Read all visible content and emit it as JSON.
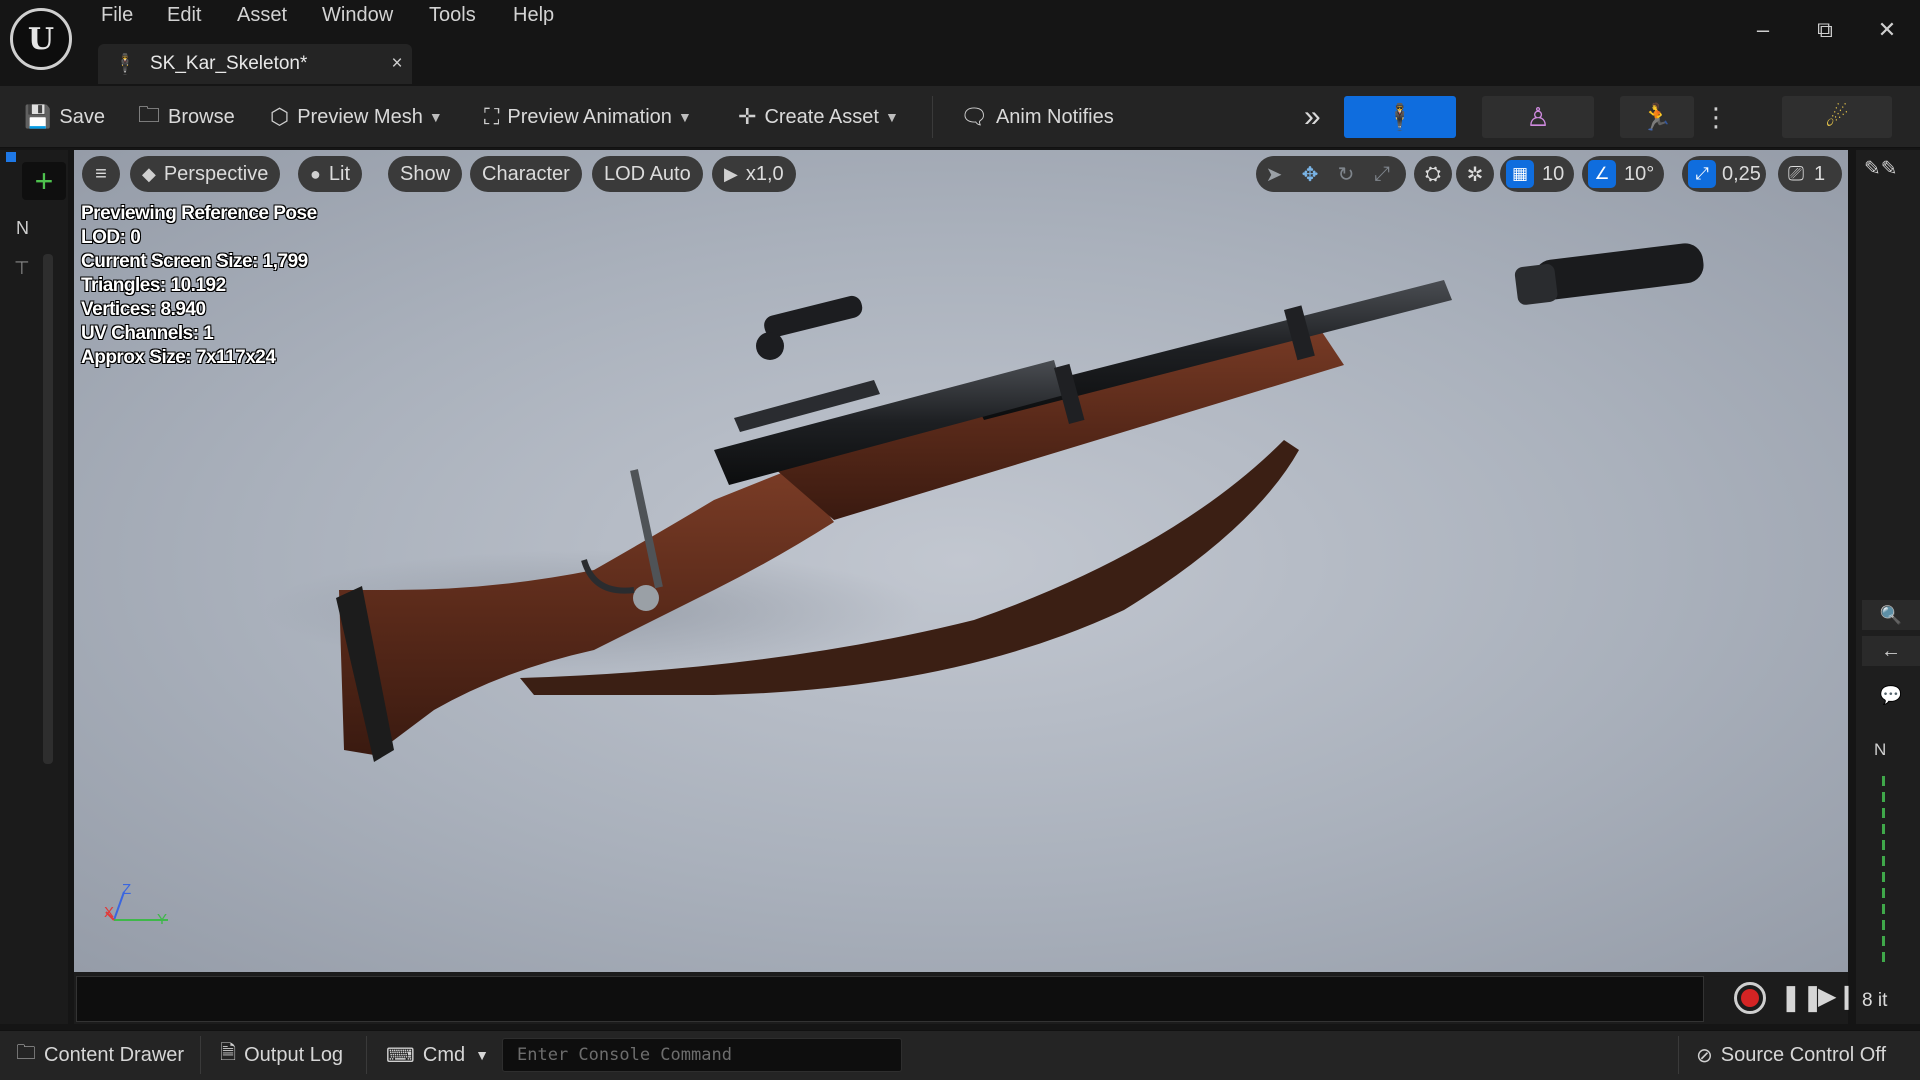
{
  "menu": [
    "File",
    "Edit",
    "Asset",
    "Window",
    "Tools",
    "Help"
  ],
  "tab": {
    "label": "SK_Kar_Skeleton*",
    "close": "×"
  },
  "window_controls": {
    "minimize": "–",
    "restore": "⧉",
    "close": "✕"
  },
  "toolbar": {
    "save": "Save",
    "browse": "Browse",
    "preview_mesh": "Preview Mesh",
    "preview_animation": "Preview Animation",
    "create_asset": "Create Asset",
    "anim_notifies": "Anim Notifies",
    "overflow": "»"
  },
  "viewport": {
    "menu_icon": "≡",
    "perspective": "Perspective",
    "lit": "Lit",
    "show": "Show",
    "character": "Character",
    "lod": "LOD Auto",
    "play_rate": "x1,0",
    "grid_snap": "10",
    "rotation_snap": "10°",
    "scale_snap": "0,25",
    "camera_speed": "1",
    "stats": [
      "Previewing Reference Pose",
      "LOD: 0",
      "Current Screen Size: 1,799",
      "Triangles: 10.192",
      "Vertices: 8.940",
      "UV Channels: 1",
      "Approx Size: 7x117x24"
    ],
    "axis_labels": {
      "z": "Z",
      "x": "X",
      "y": "Y"
    }
  },
  "left_panel": {
    "add": "+",
    "n_label": "N"
  },
  "right_panel": {
    "rate": "8 it",
    "n_label": "N"
  },
  "statusbar": {
    "content_drawer": "Content Drawer",
    "output_log": "Output Log",
    "cmd": "Cmd",
    "console_placeholder": "Enter Console Command",
    "source_control": "Source Control Off"
  },
  "colors": {
    "accent_blue": "#0f6dde",
    "record_red": "#d42424",
    "add_green": "#4ec24e",
    "viewport_bg": "#aab1bc"
  }
}
